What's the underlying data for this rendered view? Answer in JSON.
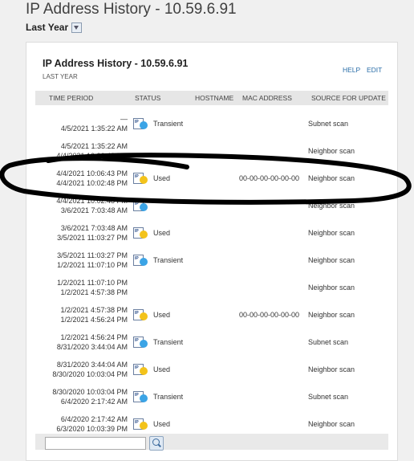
{
  "page": {
    "title": "IP Address History - 10.59.6.91"
  },
  "range": {
    "label": "Last Year"
  },
  "panel": {
    "title": "IP Address History - 10.59.6.91",
    "subtitle": "LAST YEAR",
    "help": "HELP",
    "edit": "EDIT"
  },
  "table": {
    "headers": {
      "period": "TIME PERIOD",
      "status": "STATUS",
      "hostname": "HOSTNAME",
      "mac": "MAC ADDRESS",
      "source": "SOURCE FOR UPDATE"
    },
    "rows": [
      {
        "end": "—",
        "start": "4/5/2021 1:35:22 AM",
        "status_icon": "transient-icon",
        "status": "Transient",
        "mac": "",
        "source": "Subnet scan"
      },
      {
        "end": "4/5/2021 1:35:22 AM",
        "start": "4/4/2021 10:06:43 PM",
        "status_icon": "",
        "status": "",
        "mac": "",
        "source": "Neighbor scan"
      },
      {
        "end": "4/4/2021 10:06:43 PM",
        "start": "4/4/2021 10:02:48 PM",
        "status_icon": "used-icon",
        "status": "Used",
        "mac": "00-00-00-00-00-00",
        "source": "Neighbor scan"
      },
      {
        "end": "4/4/2021 10:02:48 PM",
        "start": "3/6/2021 7:03:48 AM",
        "status_icon": "transient-icon",
        "status": "",
        "mac": "",
        "source": "Neighbor scan"
      },
      {
        "end": "3/6/2021 7:03:48 AM",
        "start": "3/5/2021 11:03:27 PM",
        "status_icon": "used-icon",
        "status": "Used",
        "mac": "",
        "source": "Neighbor scan"
      },
      {
        "end": "3/5/2021 11:03:27 PM",
        "start": "1/2/2021 11:07:10 PM",
        "status_icon": "transient-icon",
        "status": "Transient",
        "mac": "",
        "source": "Neighbor scan"
      },
      {
        "end": "1/2/2021 11:07:10 PM",
        "start": "1/2/2021 4:57:38 PM",
        "status_icon": "",
        "status": "",
        "mac": "",
        "source": "Neighbor scan"
      },
      {
        "end": "1/2/2021 4:57:38 PM",
        "start": "1/2/2021 4:56:24 PM",
        "status_icon": "used-icon",
        "status": "Used",
        "mac": "00-00-00-00-00-00",
        "source": "Neighbor scan"
      },
      {
        "end": "1/2/2021 4:56:24 PM",
        "start": "8/31/2020 3:44:04 AM",
        "status_icon": "transient-icon",
        "status": "Transient",
        "mac": "",
        "source": "Subnet scan"
      },
      {
        "end": "8/31/2020 3:44:04 AM",
        "start": "8/30/2020 10:03:04 PM",
        "status_icon": "used-icon",
        "status": "Used",
        "mac": "",
        "source": "Neighbor scan"
      },
      {
        "end": "8/30/2020 10:03:04 PM",
        "start": "6/4/2020 2:17:42 AM",
        "status_icon": "transient-icon",
        "status": "Transient",
        "mac": "",
        "source": "Subnet scan"
      },
      {
        "end": "6/4/2020 2:17:42 AM",
        "start": "6/3/2020 10:03:39 PM",
        "status_icon": "used-icon",
        "status": "Used",
        "mac": "",
        "source": "Neighbor scan"
      }
    ]
  },
  "colors": {
    "transient": "#3ba4e6",
    "used": "#f3c31b",
    "link": "#2a6ea8"
  }
}
